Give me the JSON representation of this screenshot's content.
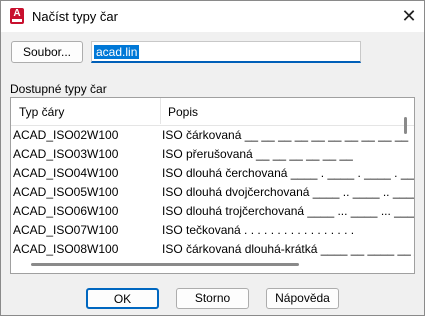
{
  "window": {
    "title": "Načíst typy čar",
    "close_glyph": "✕",
    "app_icon_letter": "A"
  },
  "file": {
    "button_label": "Soubor...",
    "value": "acad.lin"
  },
  "list": {
    "label": "Dostupné typy čar",
    "columns": [
      "Typ čáry",
      "Popis"
    ],
    "rows": [
      {
        "name": "ACAD_ISO02W100",
        "desc": "ISO čárkovaná __ __ __ __ __ __ __ __ __ __"
      },
      {
        "name": "ACAD_ISO03W100",
        "desc": "ISO přerušovaná __    __    __    __    __    __"
      },
      {
        "name": "ACAD_ISO04W100",
        "desc": "ISO dlouhá čerchovaná ____ . ____ . ____ . ____"
      },
      {
        "name": "ACAD_ISO05W100",
        "desc": "ISO dlouhá dvojčerchovaná ____ .. ____ .. ____"
      },
      {
        "name": "ACAD_ISO06W100",
        "desc": "ISO dlouhá trojčerchovaná ____ ... ____ ... ____"
      },
      {
        "name": "ACAD_ISO07W100",
        "desc": "ISO tečkovaná . . . . . . . . . . . . . . . . ."
      },
      {
        "name": "ACAD_ISO08W100",
        "desc": "ISO čárkovaná dlouhá-krátká ____ __ ____ __ ____"
      }
    ]
  },
  "buttons": {
    "ok": "OK",
    "cancel": "Storno",
    "help": "Nápověda"
  },
  "colors": {
    "accent": "#0078d7",
    "app_icon": "#c8102e"
  }
}
